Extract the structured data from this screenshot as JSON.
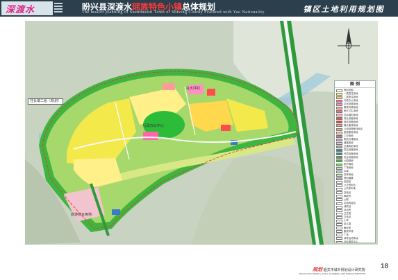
{
  "header": {
    "logo_text": "深渡水",
    "title_cn_prefix": "盼兴县深渡水",
    "title_cn_highlight": "瑶族特色小镇",
    "title_cn_suffix": "总体规划",
    "title_en": "The master planning of Shendushui Town of Shixing County Featured with Yao Nationality",
    "section_title": "镇区土地利用规划图"
  },
  "map": {
    "labels": {
      "village_left": "往长墩二组（规划）",
      "village_right": "往大坪村",
      "tourism_center": "旅游综合用地",
      "town_center": "行政办公中心"
    }
  },
  "legend": {
    "title": "图  例",
    "items": [
      {
        "label": "规划范围",
        "color": "#ffffff"
      },
      {
        "label": "一类居住用地",
        "color": "#fff08a"
      },
      {
        "label": "二类居住用地",
        "color": "#ffd84d"
      },
      {
        "label": "行政办公用地",
        "color": "#ff66aa"
      },
      {
        "label": "文化设施用地",
        "color": "#ff8fc4"
      },
      {
        "label": "教育科研用地",
        "color": "#ff9b9b"
      },
      {
        "label": "医疗卫生用地",
        "color": "#ff7070"
      },
      {
        "label": "社会福利用地",
        "color": "#ffb3b3"
      },
      {
        "label": "商业设施用地",
        "color": "#ff4d4d"
      },
      {
        "label": "商务设施用地",
        "color": "#e83a3a"
      },
      {
        "label": "娱乐康体用地",
        "color": "#ff9f80"
      },
      {
        "label": "公用设施营业网点",
        "color": "#f5b27a"
      },
      {
        "label": "旅游服务用地",
        "color": "#f2c4ce"
      },
      {
        "label": "工业用地",
        "color": "#b38b6d"
      },
      {
        "label": "物流仓储用地",
        "color": "#c89bd6"
      },
      {
        "label": "道路用地",
        "color": "#d9d9d9"
      },
      {
        "label": "交通场站用地",
        "color": "#a6a6a6"
      },
      {
        "label": "供应设施用地",
        "color": "#3b7dc4"
      },
      {
        "label": "环境设施用地",
        "color": "#2f8f7f"
      },
      {
        "label": "安全设施用地",
        "color": "#6c9a3b"
      },
      {
        "label": "公园绿地",
        "color": "#2dbb3a"
      },
      {
        "label": "防护绿地",
        "color": "#7ad35a"
      },
      {
        "label": "广场用地",
        "color": "#c9e6a3"
      },
      {
        "label": "水域",
        "color": "#9fd1ea"
      },
      {
        "label": "农林用地",
        "color": "#cfe5a8"
      },
      {
        "label": "规划道路",
        "color": "#b0b0b0"
      },
      {
        "label": "加油站",
        "color": "#ffffff"
      },
      {
        "label": "公交首末站",
        "color": "#ffffff"
      },
      {
        "label": "公共停车场",
        "color": "#ffffff"
      },
      {
        "label": "变电站",
        "color": "#ffffff"
      },
      {
        "label": "邮政所",
        "color": "#ffffff"
      },
      {
        "label": "公厕",
        "color": "#ffffff"
      },
      {
        "label": "垃圾转运站",
        "color": "#ffffff"
      },
      {
        "label": "消防站",
        "color": "#ffffff"
      },
      {
        "label": "派出所",
        "color": "#ffffff"
      },
      {
        "label": "卫生院",
        "color": "#ffffff"
      },
      {
        "label": "文化站",
        "color": "#ffffff"
      },
      {
        "label": "小学",
        "color": "#ffffff"
      },
      {
        "label": "幼儿园",
        "color": "#ffffff"
      },
      {
        "label": "敬老院",
        "color": "#ffffff"
      },
      {
        "label": "集贸市场",
        "color": "#ffffff"
      },
      {
        "label": "广场",
        "color": "#ffffff"
      },
      {
        "label": "体育活动场地",
        "color": "#ffffff"
      },
      {
        "label": "社区服务中心",
        "color": "#ffffff"
      },
      {
        "label": "旅游服务中心",
        "color": "#ffffff"
      },
      {
        "label": "污水处理设施",
        "color": "#ffffff"
      }
    ]
  },
  "footer": {
    "org_mark": "规划",
    "org_cn": "韶关市城乡规划设计研究院",
    "org_en": "SHAOGUAN URBAN & RURAL PLANNING AND DESIGN INSTITUTE",
    "page_number": "18"
  }
}
